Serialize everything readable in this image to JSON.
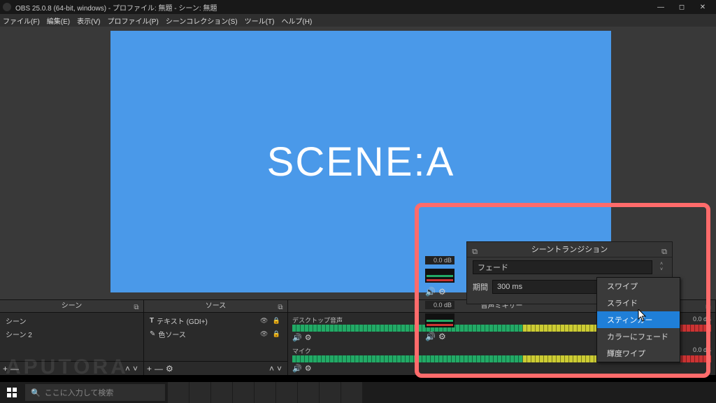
{
  "titlebar": {
    "title": "OBS 25.0.8 (64-bit, windows) - プロファイル: 無題 - シーン: 無題"
  },
  "menu": [
    "ファイル(F)",
    "編集(E)",
    "表示(V)",
    "プロファイル(P)",
    "シーンコレクション(S)",
    "ツール(T)",
    "ヘルプ(H)"
  ],
  "preview": {
    "text": "SCENE:A"
  },
  "docks": {
    "scenes": {
      "title": "シーン",
      "items": [
        "シーン",
        "シーン 2"
      ]
    },
    "sources": {
      "title": "ソース",
      "items": [
        {
          "icon": "T",
          "label": "テキスト (GDI+)"
        },
        {
          "icon": "✎",
          "label": "色ソース"
        }
      ]
    },
    "mixer": {
      "title": "音声ミキサー",
      "channels": [
        {
          "name": "デスクトップ音声",
          "db": "0.0 dB"
        },
        {
          "name": "マイク",
          "db": "0.0 dB"
        }
      ]
    }
  },
  "transition": {
    "title": "シーントランジション",
    "current": "フェード",
    "duration_label": "期間",
    "duration": "300 ms",
    "options": [
      "スワイプ",
      "スライド",
      "スティンガー",
      "カラーにフェード",
      "輝度ワイプ"
    ],
    "selected_index": 2
  },
  "mini": {
    "db": "0.0 dB"
  },
  "taskbar": {
    "search_placeholder": "ここに入力して検索"
  },
  "watermark": "APUTORA"
}
